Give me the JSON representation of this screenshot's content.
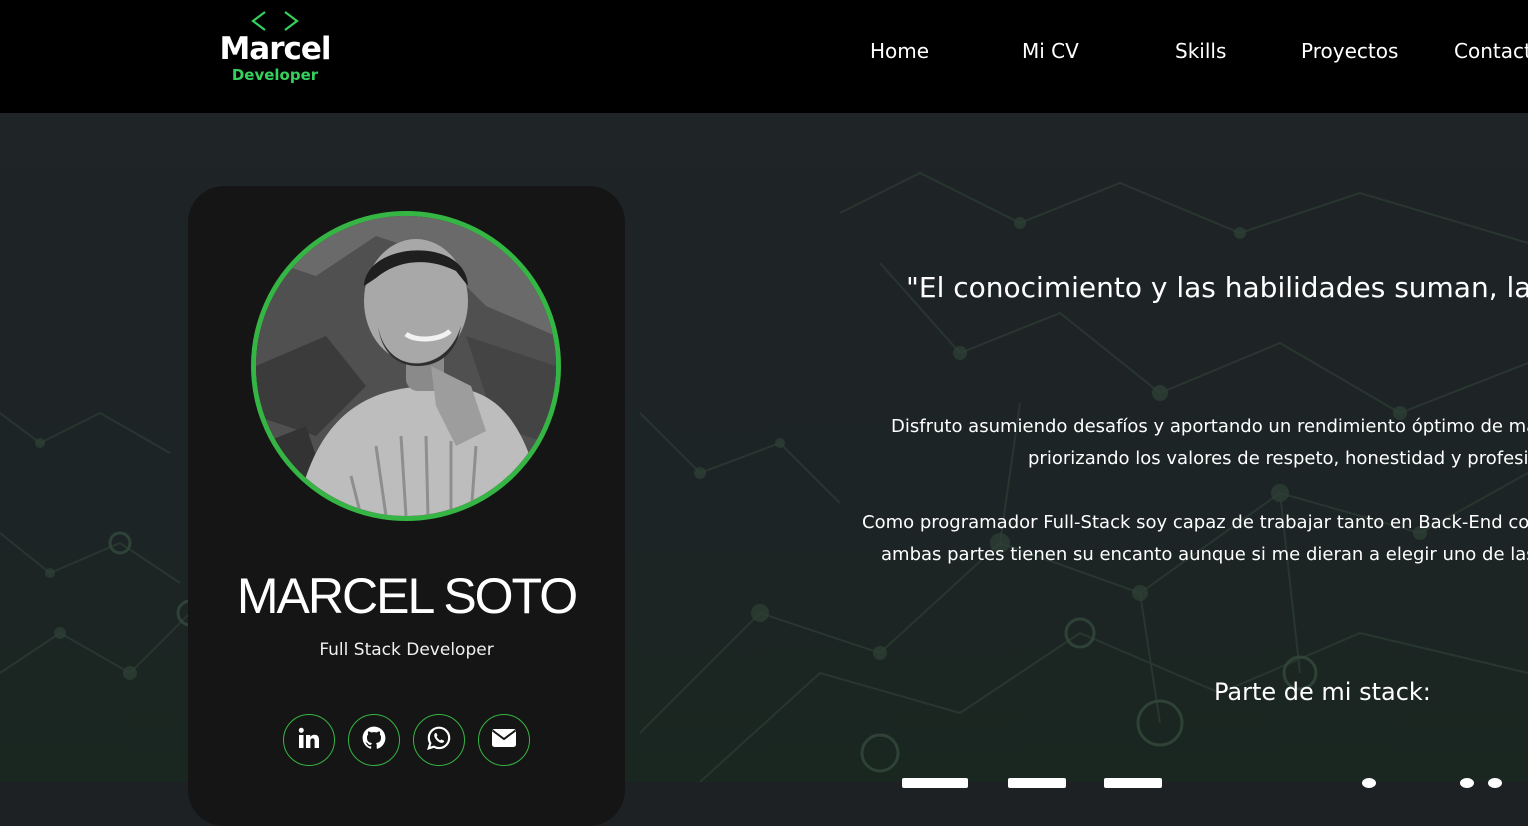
{
  "header": {
    "logo_name": "Marcel",
    "logo_role": "Developer",
    "logo_icon": "code-brackets-icon",
    "nav": [
      {
        "label": "Home"
      },
      {
        "label": "Mi CV"
      },
      {
        "label": "Skills"
      },
      {
        "label": "Proyectos"
      },
      {
        "label": "Contact"
      }
    ]
  },
  "profile": {
    "name": "MARCEL SOTO",
    "role": "Full Stack Developer",
    "socials": [
      {
        "icon": "linkedin-icon"
      },
      {
        "icon": "github-icon"
      },
      {
        "icon": "whatsapp-icon"
      },
      {
        "icon": "envelope-icon"
      }
    ]
  },
  "about": {
    "quote": "\"El conocimiento y las habilidades suman, la act",
    "paragraph1": [
      "Disfruto asumiendo desafíos y aportando un rendimiento óptimo de ma",
      "priorizando los valores de respeto, honestidad y profesio"
    ],
    "paragraph2": [
      "Como programador Full-Stack soy capaz de trabajar tanto en Back-End com",
      "ambas partes tienen su encanto aunque si me dieran a elegir uno de las d"
    ],
    "stack_title": "Parte de mi stack:"
  },
  "colors": {
    "accent": "#35b543",
    "logo_accent": "#35d15c",
    "header_bg": "#000000",
    "card_bg": "#151515",
    "page_bg": "#1d2123"
  }
}
